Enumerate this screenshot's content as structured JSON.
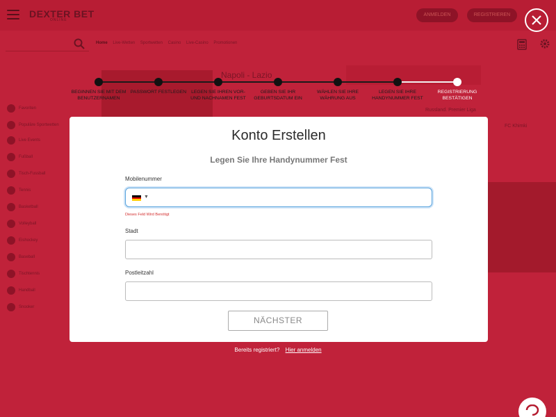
{
  "header": {
    "logo": "DEXTER BET",
    "logo_sub": "ONLINE",
    "login_label": "ANMELDEN",
    "register_label": "REGISTRIEREN"
  },
  "background": {
    "nav_links": [
      "Home",
      "Live-Wetten",
      "Sportwetten",
      "Casino",
      "Live-Casino",
      "Promotionen"
    ],
    "match_title": "Napoli - Lazio",
    "sidebar_items": [
      "Favoriten",
      "Populäre Sportwetten",
      "Live Events",
      "Fußball",
      "Tisch-Fussball",
      "Tennis",
      "Basketball",
      "Volleyball",
      "Eishockey",
      "Baseball",
      "Tischtennis",
      "Handball",
      "Snooker"
    ],
    "right_league": "Russland. Premier Liga",
    "right_club": "FC Khimki"
  },
  "stepper": {
    "steps": [
      {
        "label": "Beginnen Sie mit dem Benutzernamen",
        "active": false
      },
      {
        "label": "Passwort festlegen",
        "active": false
      },
      {
        "label": "Legen Sie Ihren Vor- und Nachnamen fest",
        "active": false
      },
      {
        "label": "Geben Sie Ihr Geburtsdatum ein",
        "active": false
      },
      {
        "label": "Wählen Sie Ihre Währung aus",
        "active": false
      },
      {
        "label": "Legen Sie Ihre Handynummer fest",
        "active": false
      },
      {
        "label": "Registrierung bestätigen",
        "active": true
      }
    ]
  },
  "modal": {
    "title": "Konto Erstellen",
    "subtitle": "Legen Sie Ihre Handynummer Fest",
    "mobile_label": "Mobilenummer",
    "mobile_value": "",
    "mobile_country": "DE",
    "mobile_error": "Dieses Feld Wird Benötigt",
    "city_label": "Stadt",
    "city_value": "",
    "zip_label": "Postleitzahl",
    "zip_value": "",
    "next_label": "NÄCHSTER"
  },
  "footer": {
    "already_registered": "Bereits registriert?",
    "login_link": "Hier anmelden"
  },
  "colors": {
    "backdrop": "#c0223a",
    "error": "#d32f2f",
    "focus_border": "#5aa4dd"
  }
}
